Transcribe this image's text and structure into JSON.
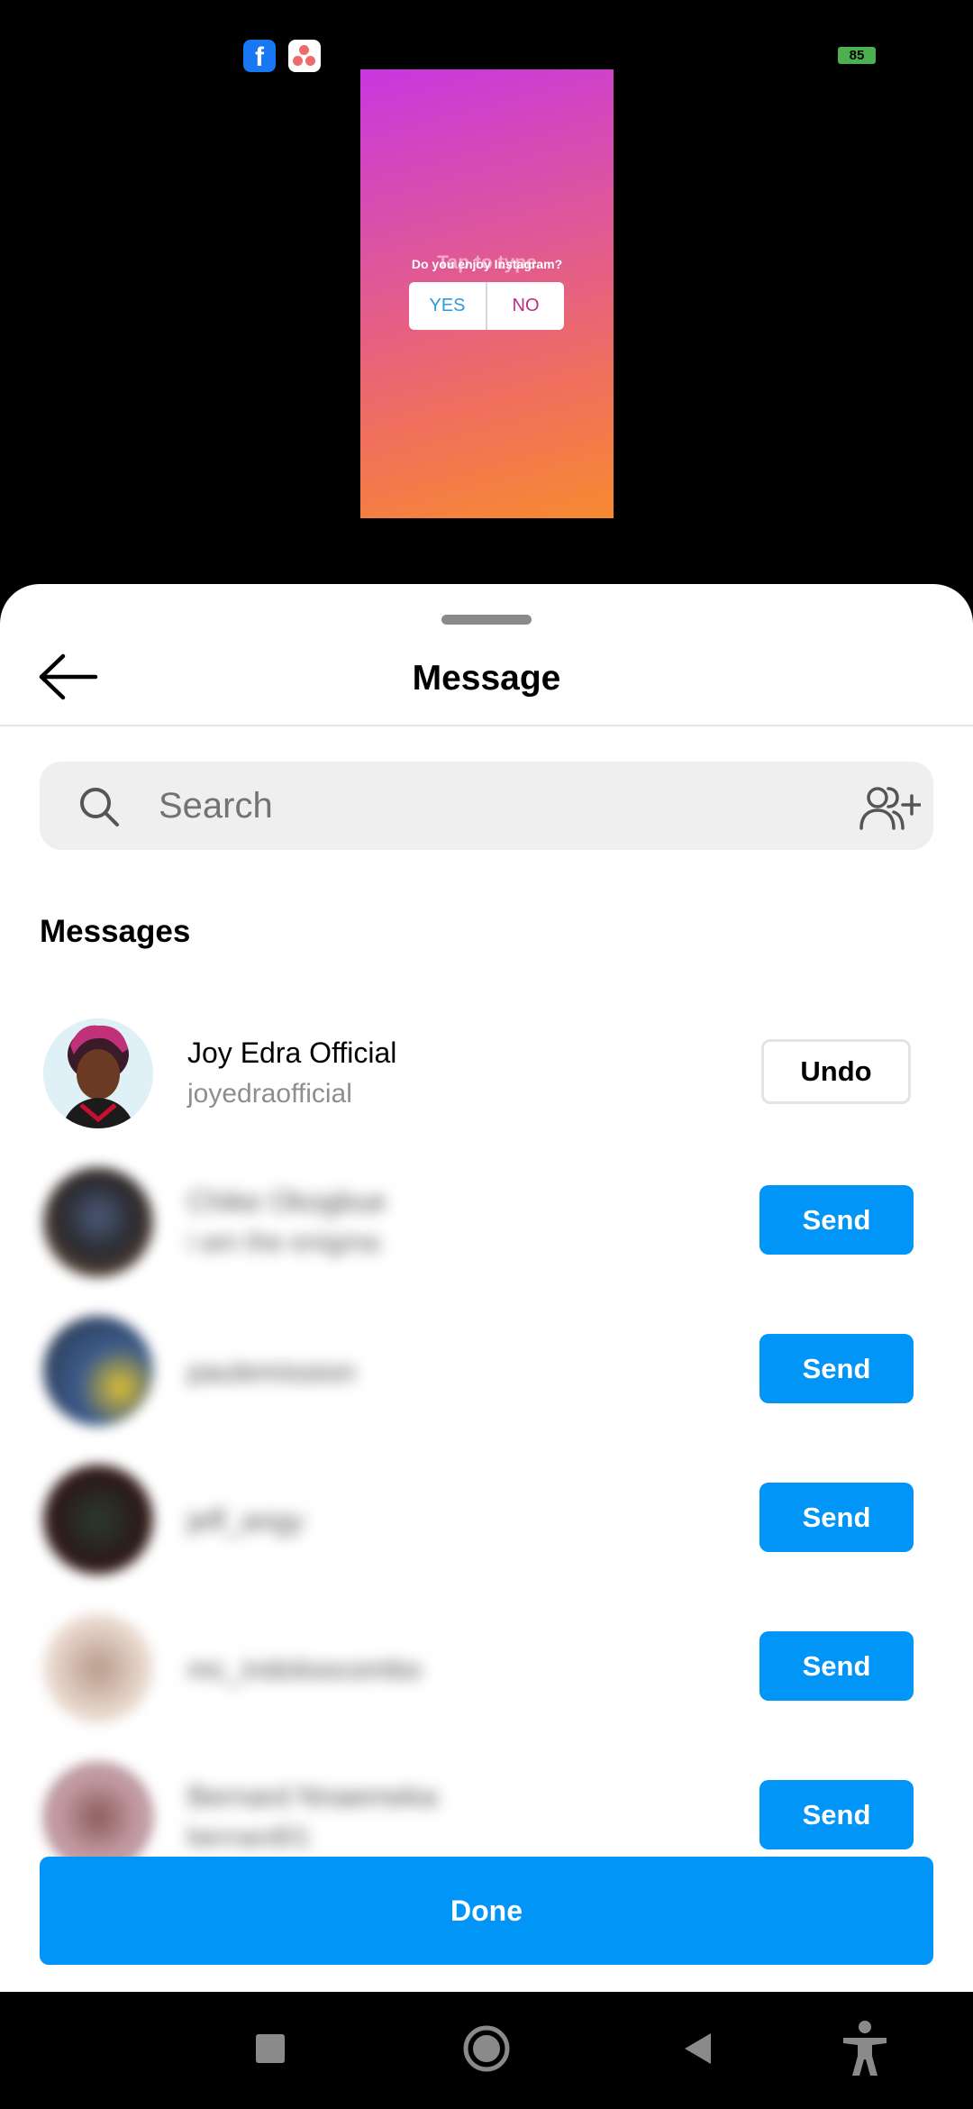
{
  "status_bar": {
    "app_icons": [
      "facebook-icon",
      "asana-icon"
    ],
    "battery": "85"
  },
  "story": {
    "placeholder": "Tap to type",
    "question": "Do you enjoy Instagram?",
    "options": [
      "YES",
      "NO"
    ],
    "colors": {
      "top": "#c837e0",
      "bottom": "#f78a30"
    }
  },
  "sheet": {
    "title": "Message",
    "search": {
      "placeholder": "Search"
    },
    "section_label": "Messages",
    "contacts": [
      {
        "name": "Joy Edra Official",
        "username": "joyedraofficial",
        "action": "Undo"
      },
      {
        "name": "Chike Okogbue",
        "username": "i am the enigma",
        "action": "Send"
      },
      {
        "name": "paulemission",
        "username": "",
        "action": "Send"
      },
      {
        "name": "jeff_angy",
        "username": "",
        "action": "Send"
      },
      {
        "name": "mc_indoloocombo",
        "username": "",
        "action": "Send"
      },
      {
        "name": "Bernard Nnaemeka",
        "username": "bernard01",
        "action": "Send"
      }
    ],
    "done_label": "Done"
  },
  "nav_bar": {
    "buttons": [
      "recents-icon",
      "home-icon",
      "back-icon",
      "accessibility-icon"
    ]
  },
  "colors": {
    "accent": "#0095f6",
    "search_bg": "#efefef",
    "secondary_text": "#8e8e8e"
  }
}
